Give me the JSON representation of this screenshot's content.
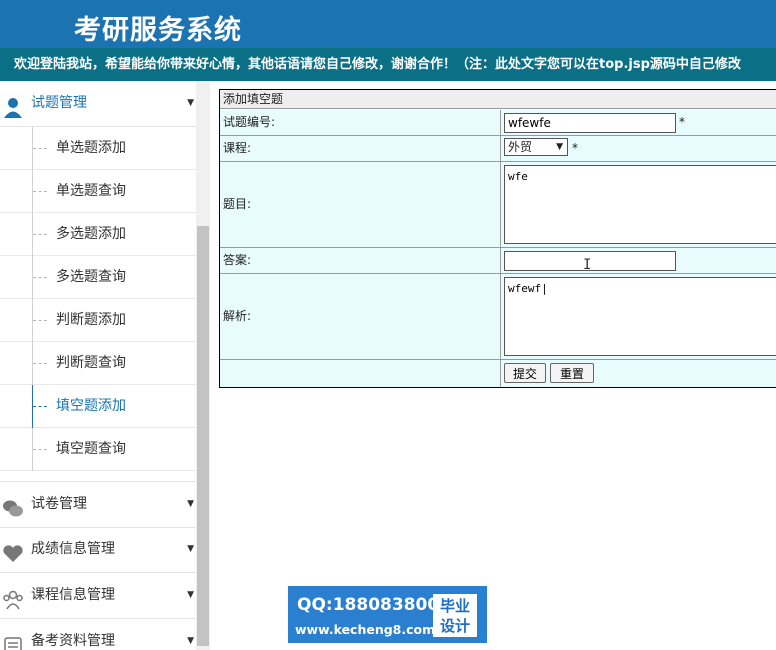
{
  "app": {
    "title": "考研服务系统"
  },
  "notice": "欢迎登陆我站，希望能给你带来好心情，其他话语请您自己修改，谢谢合作！（注：此处文字您可以在top.jsp源码中自己修改",
  "sidebar": {
    "groups": [
      {
        "label": "试题管理",
        "icon": "user-icon",
        "expanded": true
      },
      {
        "label": "试卷管理",
        "icon": "chat-icon"
      },
      {
        "label": "成绩信息管理",
        "icon": "heart-icon"
      },
      {
        "label": "课程信息管理",
        "icon": "people-icon"
      },
      {
        "label": "备考资料管理",
        "icon": "notes-icon"
      }
    ],
    "items": [
      {
        "label": "单选题添加"
      },
      {
        "label": "单选题查询"
      },
      {
        "label": "多选题添加"
      },
      {
        "label": "多选题查询"
      },
      {
        "label": "判断题添加"
      },
      {
        "label": "判断题查询"
      },
      {
        "label": "填空题添加",
        "active": true
      },
      {
        "label": "填空题查询"
      }
    ]
  },
  "form": {
    "title": "添加填空题",
    "fields": {
      "id": {
        "label": "试题编号:",
        "value": "wfewfe",
        "required": "*"
      },
      "course": {
        "label": "课程:",
        "selected": "外贸",
        "required": "*"
      },
      "question": {
        "label": "题目:",
        "value": "wfe"
      },
      "answer": {
        "label": "答案:",
        "value": ""
      },
      "analysis": {
        "label": "解析:",
        "value": "wfewf|"
      }
    },
    "buttons": {
      "submit": "提交",
      "reset": "重置"
    }
  },
  "watermark": {
    "qq": "QQ:188083800",
    "url": "www.kecheng8.com",
    "badge_line1": "毕业",
    "badge_line2": "设计"
  },
  "colors": {
    "header": "#1c73b2",
    "notice_bar": "#0b6f86",
    "form_cell": "#e8fbfd"
  }
}
